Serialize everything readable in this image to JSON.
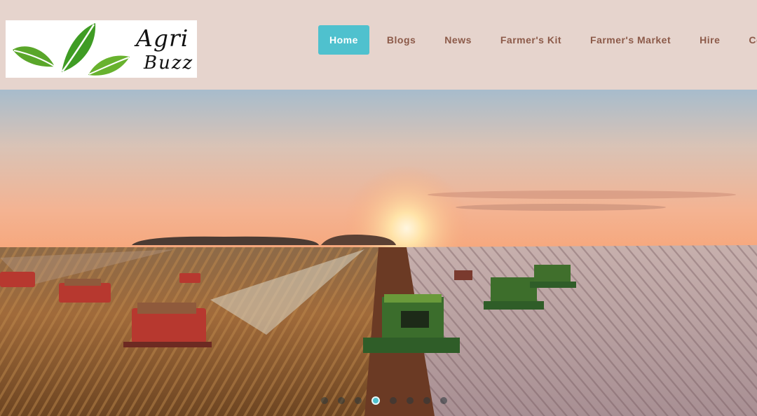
{
  "logo": {
    "line1": "Agri",
    "line2": "Buzz"
  },
  "nav": {
    "items": [
      "Home",
      "Blogs",
      "News",
      "Farmer's Kit",
      "Farmer's Market",
      "Hire",
      "Co"
    ],
    "active_index": 0
  },
  "hero": {
    "scene": "combine harvesters in field at sunset",
    "slide_count": 8,
    "active_slide": 3
  },
  "colors": {
    "header_bg": "#e6d4cd",
    "nav_text": "#8c5a49",
    "nav_active_bg": "#4fc1ce",
    "nav_active_text": "#ffffff"
  }
}
